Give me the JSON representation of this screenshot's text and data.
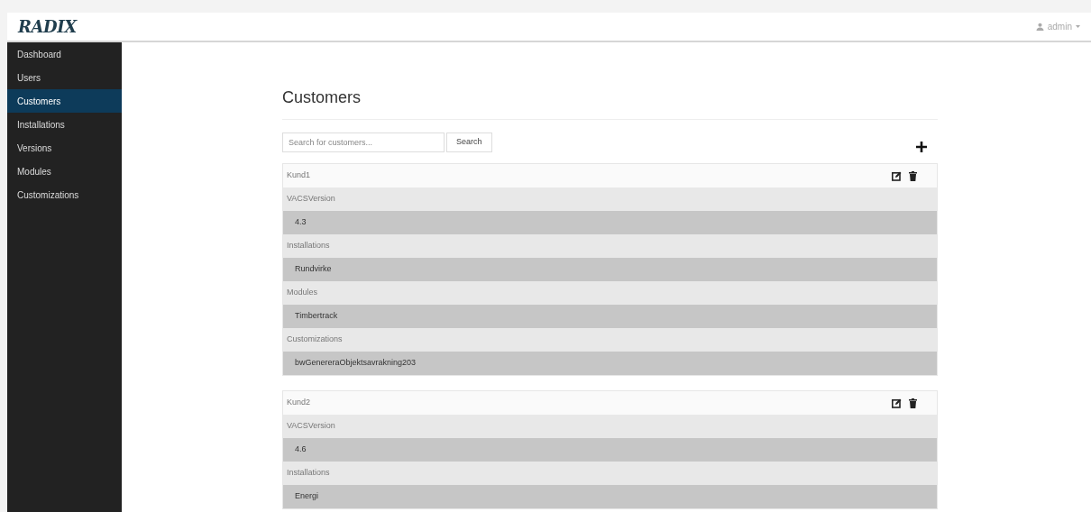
{
  "header": {
    "logo": "RADIX",
    "user": "admin"
  },
  "sidebar": {
    "items": [
      {
        "label": "Dashboard",
        "selected": false
      },
      {
        "label": "Users",
        "selected": false
      },
      {
        "label": "Customers",
        "selected": true
      },
      {
        "label": "Installations",
        "selected": false
      },
      {
        "label": "Versions",
        "selected": false
      },
      {
        "label": "Modules",
        "selected": false
      },
      {
        "label": "Customizations",
        "selected": false
      }
    ]
  },
  "page": {
    "title": "Customers",
    "search": {
      "placeholder": "Search for customers...",
      "button": "Search"
    }
  },
  "customers": [
    {
      "name": "Kund1",
      "sections": [
        {
          "label": "VACSVersion",
          "values": [
            "4.3"
          ]
        },
        {
          "label": "Installations",
          "values": [
            "Rundvirke"
          ]
        },
        {
          "label": "Modules",
          "values": [
            "Timbertrack"
          ]
        },
        {
          "label": "Customizations",
          "values": [
            "bwGenereraObjektsavrakning203"
          ]
        }
      ]
    },
    {
      "name": "Kund2",
      "sections": [
        {
          "label": "VACSVersion",
          "values": [
            "4.6"
          ]
        },
        {
          "label": "Installations",
          "values": [
            "Energi"
          ]
        }
      ]
    }
  ]
}
